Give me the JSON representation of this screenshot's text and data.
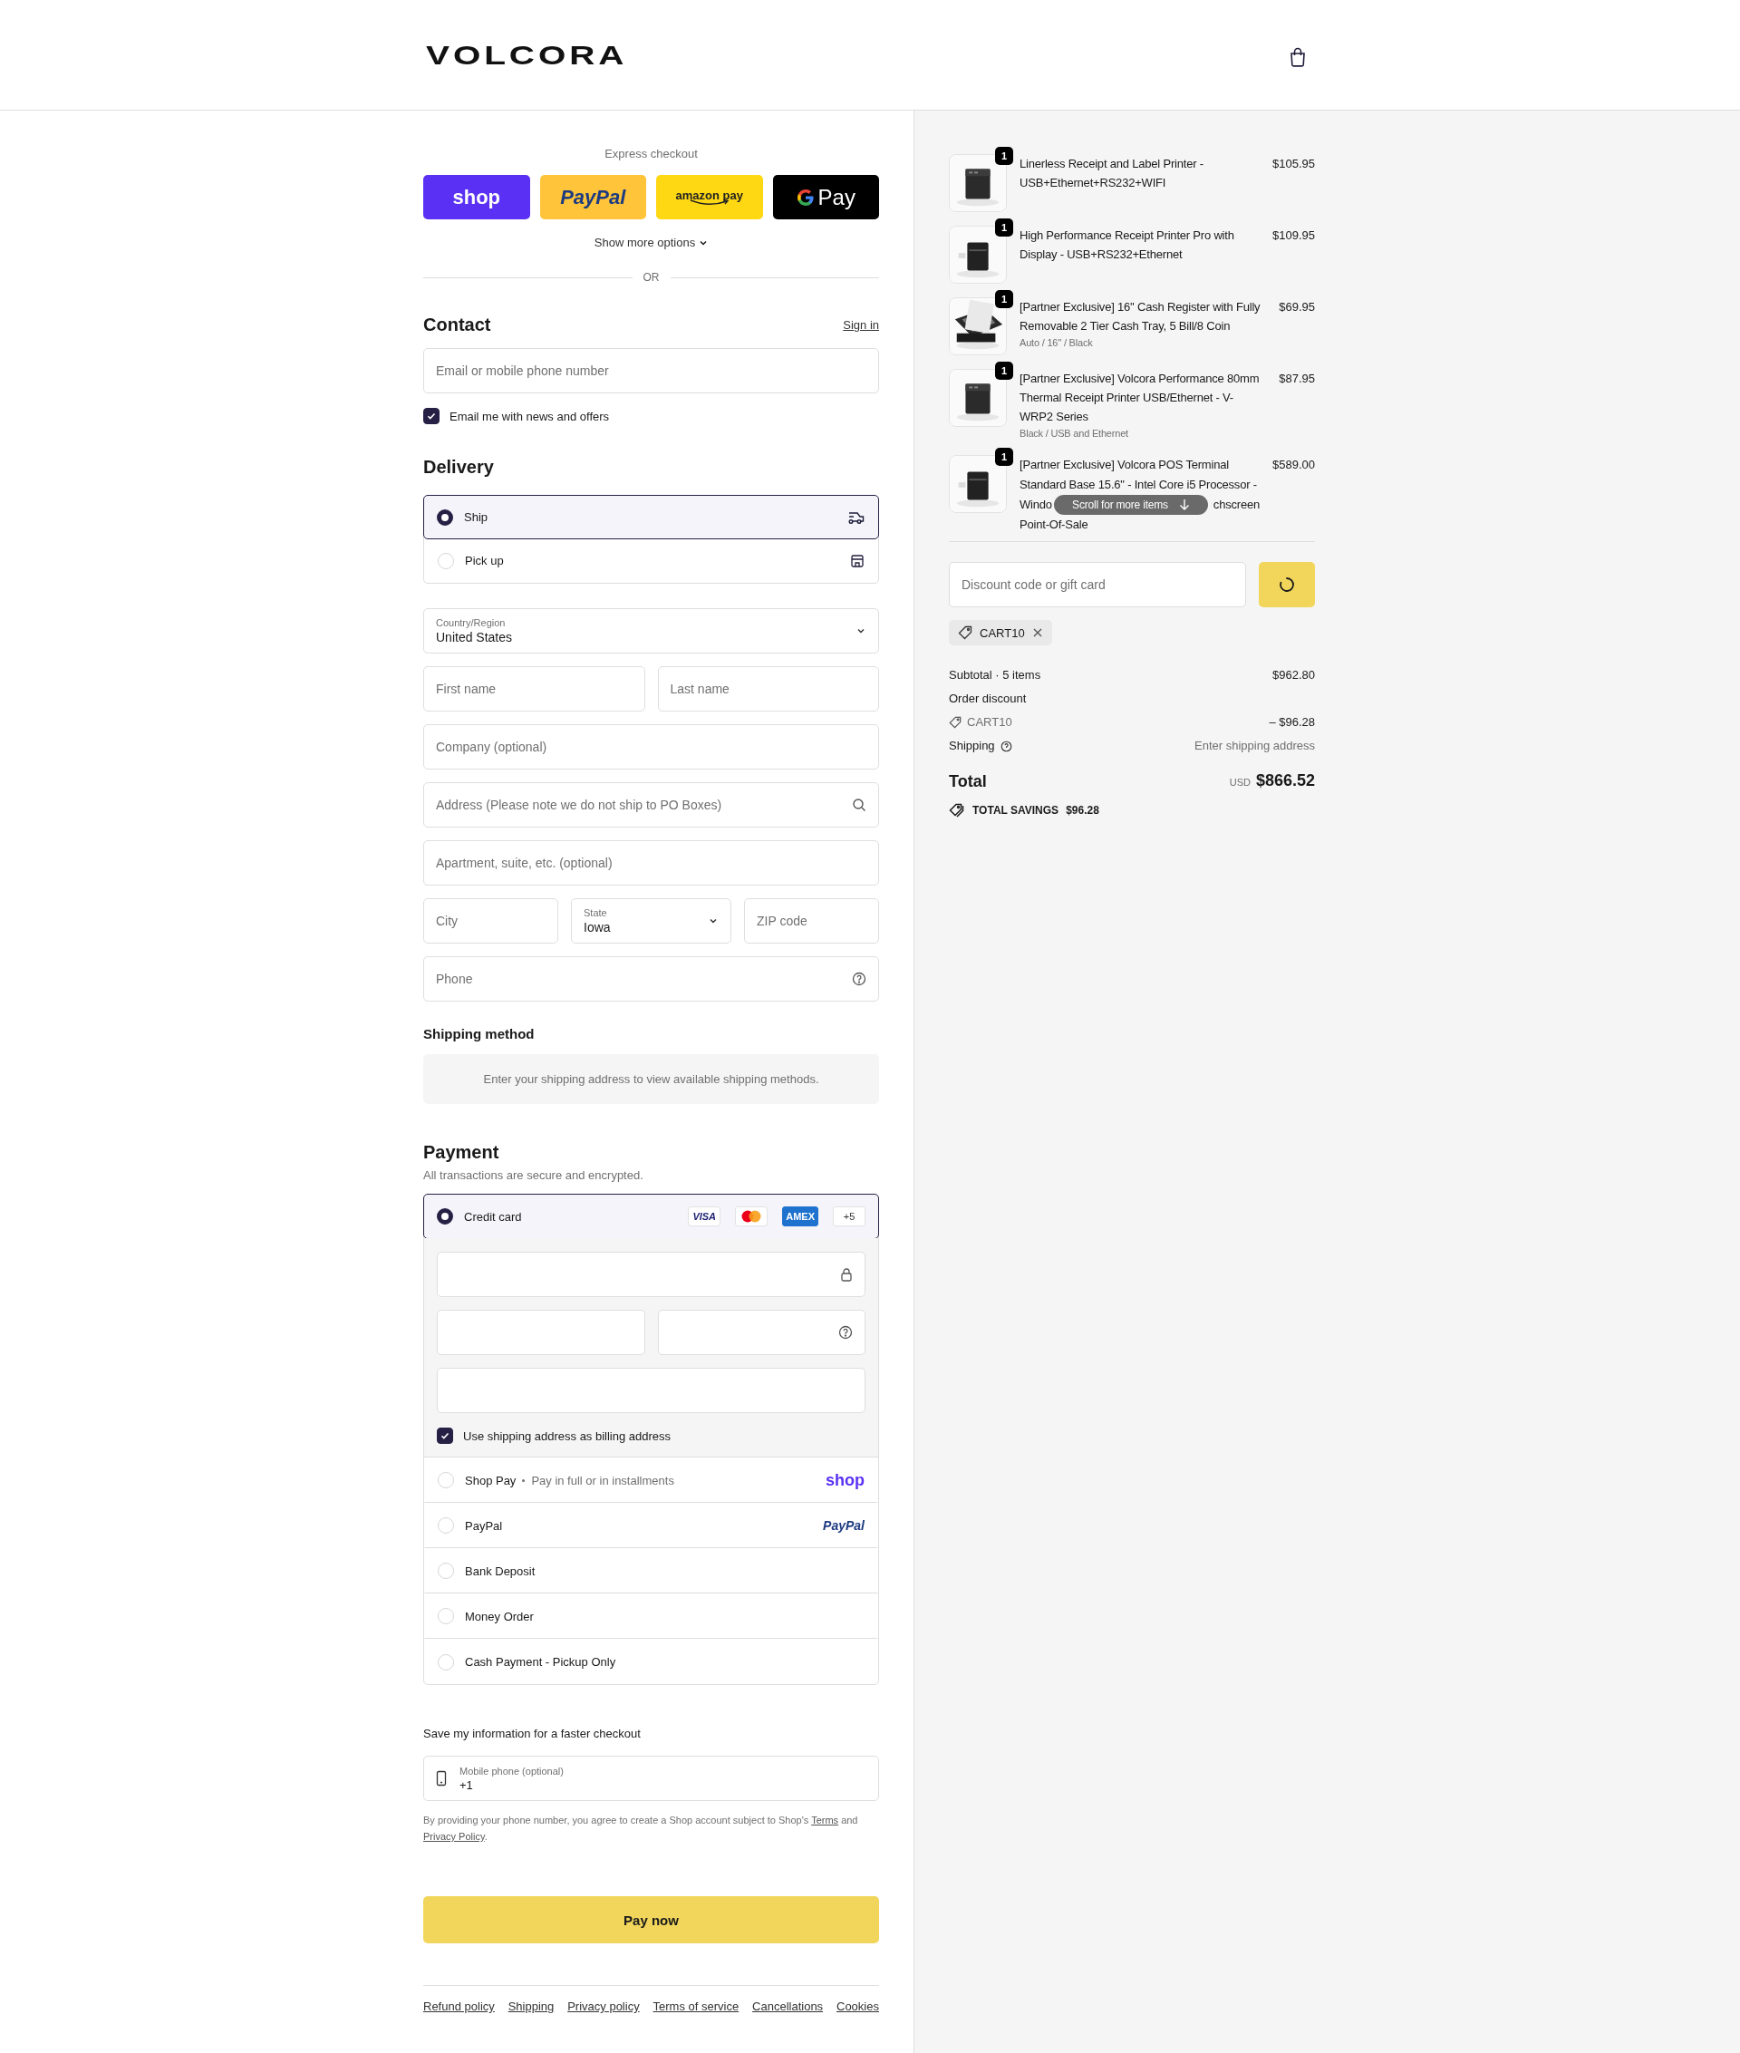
{
  "header": {
    "logo": "VOLCORA"
  },
  "express": {
    "title": "Express checkout",
    "buttons": [
      {
        "kind": "shop",
        "label": "shop"
      },
      {
        "kind": "paypal",
        "label": "PayPal"
      },
      {
        "kind": "amazon",
        "label": "amazon pay"
      },
      {
        "kind": "gpay",
        "label": "Pay"
      }
    ],
    "more": "Show more options",
    "divider": "OR"
  },
  "contact": {
    "title": "Contact",
    "sign_in": "Sign in",
    "email": {
      "placeholder": "Email or mobile phone number"
    },
    "newsletter": {
      "label": "Email me with news and offers",
      "checked": true
    }
  },
  "delivery": {
    "title": "Delivery",
    "options": [
      {
        "kind": "ship",
        "label": "Ship",
        "selected": true
      },
      {
        "kind": "pickup",
        "label": "Pick up",
        "selected": false
      }
    ],
    "rows": [
      {
        "fields": [
          {
            "kind": "select",
            "label": "Country/Region",
            "value": "United States"
          }
        ]
      },
      {
        "fields": [
          {
            "kind": "text",
            "placeholder": "First name"
          },
          {
            "kind": "text",
            "placeholder": "Last name"
          }
        ]
      },
      {
        "fields": [
          {
            "kind": "text",
            "placeholder": "Company (optional)"
          }
        ]
      },
      {
        "fields": [
          {
            "kind": "search",
            "placeholder": "Address (Please note we do not ship to PO Boxes)"
          }
        ]
      },
      {
        "fields": [
          {
            "kind": "text",
            "placeholder": "Apartment, suite, etc. (optional)"
          }
        ]
      },
      {
        "fields": [
          {
            "kind": "text",
            "placeholder": "City"
          },
          {
            "kind": "select",
            "label": "State",
            "value": "Iowa"
          },
          {
            "kind": "text",
            "placeholder": "ZIP code"
          }
        ]
      },
      {
        "fields": [
          {
            "kind": "help",
            "placeholder": "Phone"
          }
        ]
      }
    ]
  },
  "shipping_method": {
    "title": "Shipping method",
    "message": "Enter your shipping address to view available shipping methods."
  },
  "payment": {
    "title": "Payment",
    "subtitle": "All transactions are secure and encrypted.",
    "methods": [
      {
        "kind": "card",
        "label": "Credit card",
        "selected": true,
        "brands": [
          {
            "kind": "visa",
            "label": "VISA"
          },
          {
            "kind": "mastercard"
          },
          {
            "kind": "amex",
            "label": "AMEX"
          },
          {
            "kind": "more",
            "label": "+5"
          }
        ],
        "billing": {
          "label": "Use shipping address as billing address",
          "checked": true
        }
      },
      {
        "kind": "shoppay",
        "label": "Shop Pay",
        "note": "Pay in full or in installments",
        "logo": "shop",
        "selected": false
      },
      {
        "kind": "paypal",
        "label": "PayPal",
        "logo": "PayPal",
        "selected": false
      },
      {
        "kind": "plain",
        "label": "Bank Deposit",
        "selected": false
      },
      {
        "kind": "plain",
        "label": "Money Order",
        "selected": false
      },
      {
        "kind": "plain",
        "label": "Cash Payment - Pickup Only",
        "selected": false
      }
    ]
  },
  "save": {
    "title": "Save my information for a faster checkout",
    "phone": {
      "label": "Mobile phone (optional)",
      "value": "+1"
    },
    "legal": {
      "before": "By providing your phone number, you agree to create a Shop account subject to Shop's ",
      "terms": "Terms",
      "middle": " and ",
      "privacy": "Privacy Policy",
      "after": "."
    }
  },
  "pay_button": "Pay now",
  "footer_links": [
    "Refund policy",
    "Shipping",
    "Privacy policy",
    "Terms of service",
    "Cancellations",
    "Cookies"
  ],
  "summary": {
    "items": [
      {
        "quantity": "1",
        "title": "Linerless Receipt and Label Printer - USB+Ethernet+RS232+WIFI",
        "price": "$105.95"
      },
      {
        "quantity": "1",
        "title": "High Performance Receipt Printer Pro with Display - USB+RS232+Ethernet",
        "price": "$109.95"
      },
      {
        "quantity": "1",
        "title": "[Partner Exclusive] 16'' Cash Register with Fully Removable 2 Tier Cash Tray, 5 Bill/8 Coin",
        "meta": "Auto / 16'' / Black",
        "price": "$69.95"
      },
      {
        "quantity": "1",
        "title": "[Partner Exclusive] Volcora Performance 80mm Thermal Receipt Printer USB/Ethernet - V-WRP2 Series",
        "meta": "Black / USB and Ethernet",
        "price": "$87.95"
      },
      {
        "quantity": "1",
        "title_lines": [
          [
            "[Partner Exclusive] Volcora POS Terminal"
          ],
          [
            "Standard Base 15.6\" - Intel Core i5 Processor -"
          ],
          [
            "Windo",
            "chscreen"
          ],
          [
            "Point-Of-Sale"
          ]
        ],
        "price": "$589.00"
      }
    ],
    "scroll_hint": "Scroll for more items",
    "discount": {
      "placeholder": "Discount code or gift card"
    },
    "applied_code": "CART10",
    "subtotal": {
      "label": "Subtotal · 5 items",
      "value": "$962.80"
    },
    "order_discount": {
      "label": "Order discount",
      "code": "CART10",
      "value": "– $96.28"
    },
    "shipping": {
      "label": "Shipping",
      "value": "Enter shipping address"
    },
    "total": {
      "label": "Total",
      "currency": "USD",
      "value": "$866.52"
    },
    "savings": {
      "label": "TOTAL SAVINGS",
      "value": "$96.28"
    }
  }
}
